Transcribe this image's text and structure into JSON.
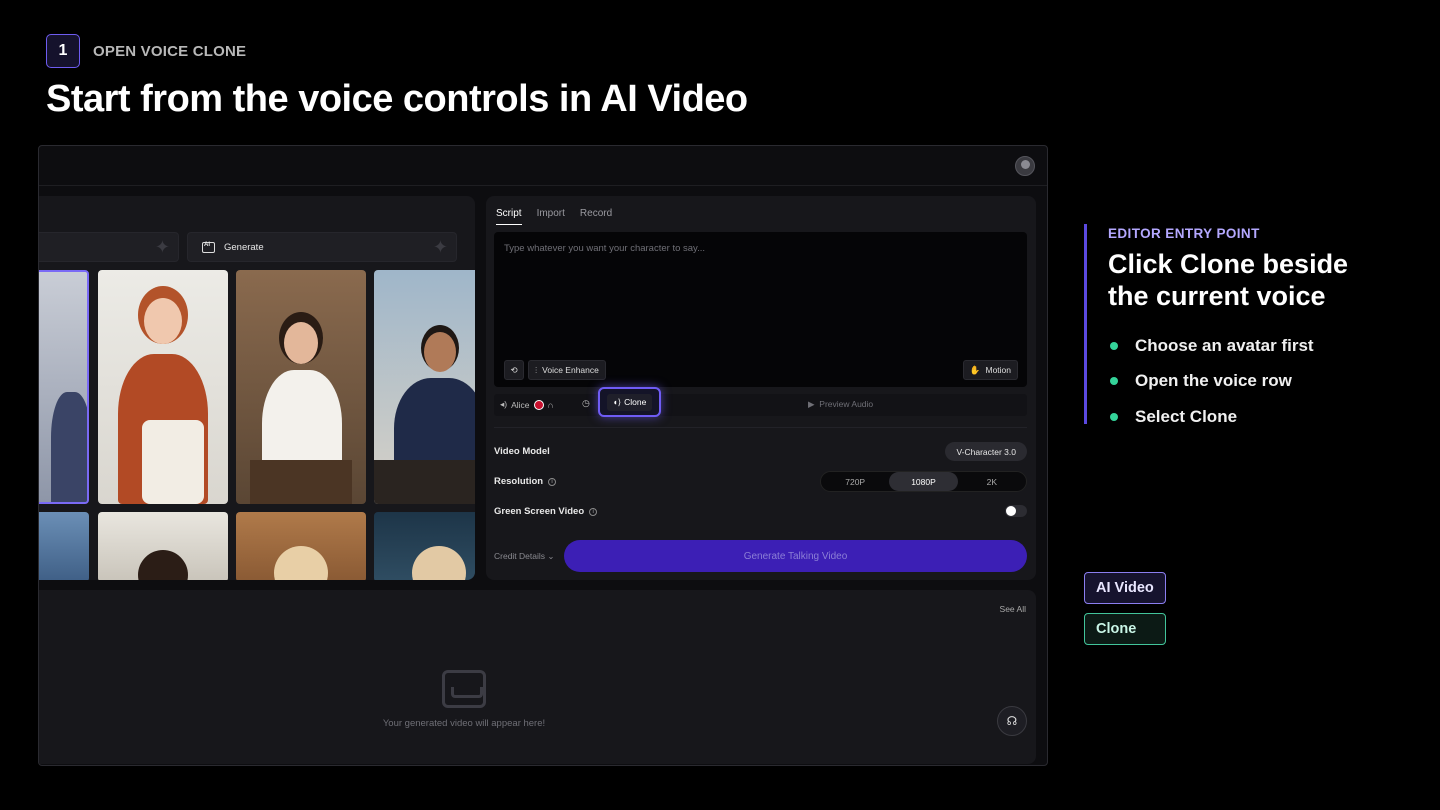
{
  "step": {
    "number": "1",
    "label": "OPEN VOICE CLONE"
  },
  "headline": "Start from the voice controls in AI Video",
  "app": {
    "avatar_panel": {
      "generate_label": "Generate"
    },
    "script_panel": {
      "tabs": [
        "Script",
        "Import",
        "Record"
      ],
      "placeholder": "Type whatever you want your character to say...",
      "voice_enhance_label": "Voice Enhance",
      "motion_label": "Motion",
      "voice_name": "Alice",
      "clone_label": "Clone",
      "preview_label": "Preview Audio",
      "video_model_label": "Video Model",
      "video_model_value": "V-Character 3.0",
      "resolution_label": "Resolution",
      "resolutions": [
        "720P",
        "1080P",
        "2K"
      ],
      "green_screen_label": "Green Screen Video",
      "green_screen_on": false,
      "credit_label": "Credit Details",
      "generate_button": "Generate Talking Video"
    },
    "gallery": {
      "see_all": "See All",
      "empty_text": "Your generated video will appear here!"
    }
  },
  "info": {
    "eyebrow": "EDITOR ENTRY POINT",
    "title_line1": "Click Clone beside",
    "title_line2": "the current voice",
    "bullets": [
      "Choose an avatar first",
      "Open the voice row",
      "Select Clone"
    ]
  },
  "tags": {
    "ai_video": "AI Video",
    "clone": "Clone"
  },
  "colors": {
    "accent": "#6f5cf5",
    "bullet": "#34d399",
    "eyebrow": "#b4a8ff"
  }
}
